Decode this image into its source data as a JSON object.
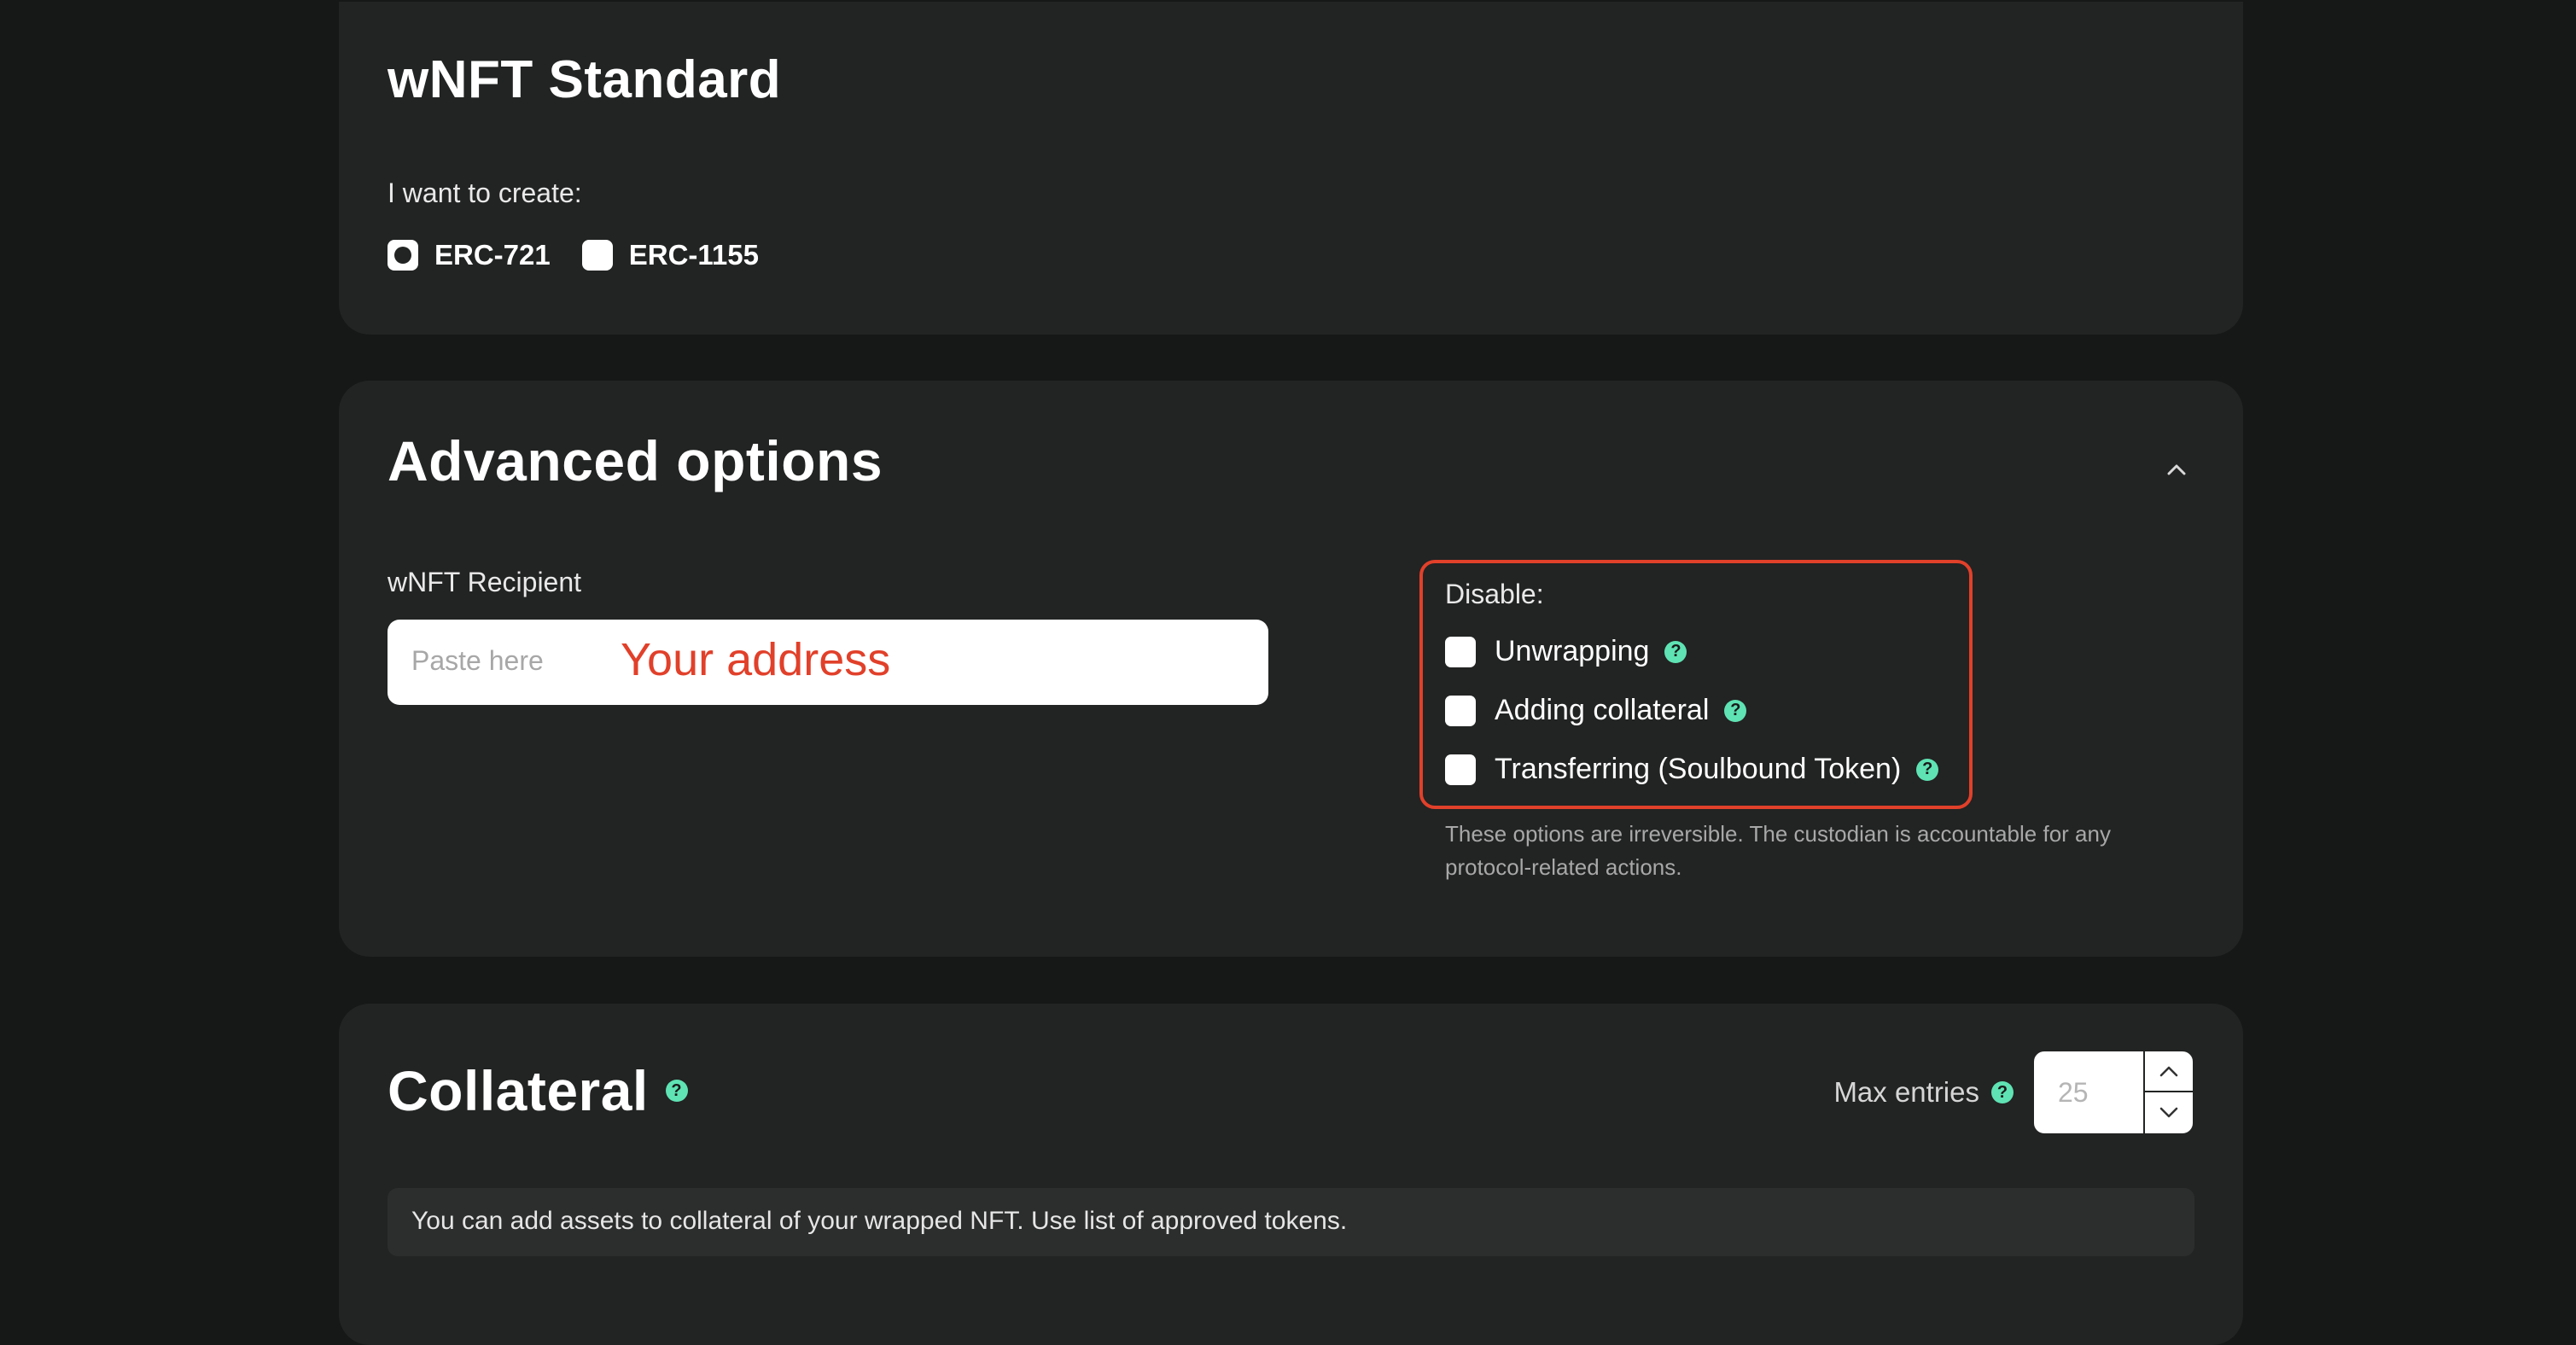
{
  "standard": {
    "title": "wNFT Standard",
    "create_label": "I want to create:",
    "options": [
      {
        "label": "ERC-721",
        "selected": true
      },
      {
        "label": "ERC-1155",
        "selected": false
      }
    ]
  },
  "advanced": {
    "title": "Advanced options",
    "recipient_label": "wNFT Recipient",
    "recipient_placeholder": "Paste here",
    "recipient_annotation": "Your address",
    "disable_label": "Disable:",
    "disable_options": [
      {
        "label": "Unwrapping",
        "checked": false
      },
      {
        "label": "Adding collateral",
        "checked": false
      },
      {
        "label": "Transferring (Soulbound Token)",
        "checked": false
      }
    ],
    "note_line1": "These options are  irreversible. The custodian is  accountable for  any",
    "note_line2": "protocol-related actions."
  },
  "collateral": {
    "title": "Collateral",
    "max_entries_label": "Max entries",
    "max_entries_value": "25",
    "info": "You can add assets to collateral of your wrapped NFT. Use list of approved tokens."
  },
  "colors": {
    "background": "#161717",
    "card": "#222323",
    "accent_help": "#5fe3b4",
    "annotation_red": "#e1402a"
  },
  "icons": {
    "help": "question-mark-circle",
    "collapse": "chevron-up",
    "step_up": "chevron-up",
    "step_down": "chevron-down"
  }
}
